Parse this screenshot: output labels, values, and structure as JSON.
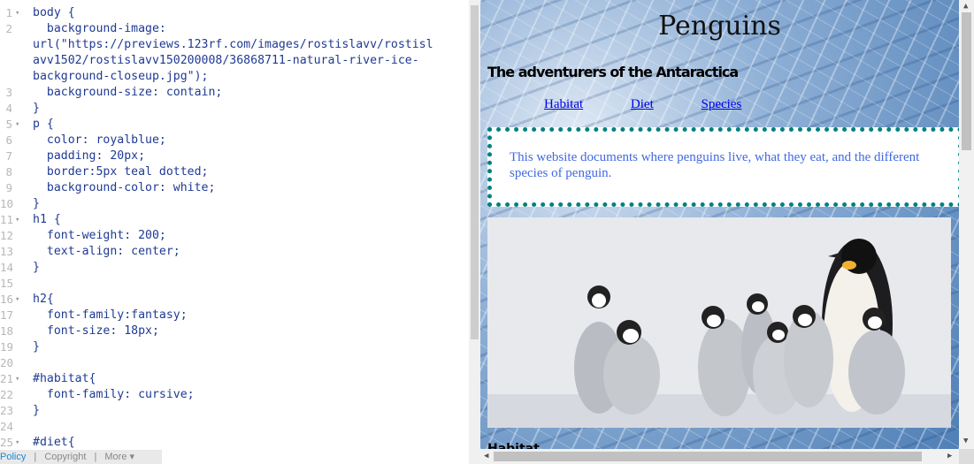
{
  "editor": {
    "lines": [
      {
        "n": "1",
        "fold": true,
        "html": "body {"
      },
      {
        "n": "2",
        "fold": false,
        "html": "  background-image:"
      },
      {
        "n": "",
        "fold": false,
        "html": "url(\"https://previews.123rf.com/images/rostislavv/rostisl"
      },
      {
        "n": "",
        "fold": false,
        "html": "avv1502/rostislavv150200008/36868711-natural-river-ice-"
      },
      {
        "n": "",
        "fold": false,
        "html": "background-closeup.jpg\");"
      },
      {
        "n": "3",
        "fold": false,
        "html": "  background-size: contain;"
      },
      {
        "n": "4",
        "fold": false,
        "html": "}"
      },
      {
        "n": "5",
        "fold": true,
        "html": "p {"
      },
      {
        "n": "6",
        "fold": false,
        "html": "  color: royalblue;"
      },
      {
        "n": "7",
        "fold": false,
        "html": "  padding: 20px;"
      },
      {
        "n": "8",
        "fold": false,
        "html": "  border:5px teal dotted;"
      },
      {
        "n": "9",
        "fold": false,
        "html": "  background-color: white;"
      },
      {
        "n": "10",
        "fold": false,
        "html": "}"
      },
      {
        "n": "11",
        "fold": true,
        "html": "h1 {"
      },
      {
        "n": "12",
        "fold": false,
        "html": "  font-weight: 200;"
      },
      {
        "n": "13",
        "fold": false,
        "html": "  text-align: center;"
      },
      {
        "n": "14",
        "fold": false,
        "html": "}"
      },
      {
        "n": "15",
        "fold": false,
        "html": ""
      },
      {
        "n": "16",
        "fold": true,
        "html": "h2{"
      },
      {
        "n": "17",
        "fold": false,
        "html": "  font-family:fantasy;"
      },
      {
        "n": "18",
        "fold": false,
        "html": "  font-size: 18px;"
      },
      {
        "n": "19",
        "fold": false,
        "html": "}"
      },
      {
        "n": "20",
        "fold": false,
        "html": ""
      },
      {
        "n": "21",
        "fold": true,
        "html": "#habitat{"
      },
      {
        "n": "22",
        "fold": false,
        "html": "  font-family: cursive;"
      },
      {
        "n": "23",
        "fold": false,
        "html": "}"
      },
      {
        "n": "24",
        "fold": false,
        "html": ""
      },
      {
        "n": "25",
        "fold": true,
        "html": "#diet{"
      }
    ],
    "footer": {
      "policy": "Policy",
      "copyright": "Copyright",
      "more": "More ▾"
    }
  },
  "preview": {
    "title": "Penguins",
    "subtitle": "The adventurers of the Antaractica",
    "nav": [
      "Habitat",
      "Diet",
      "Species"
    ],
    "paragraph": "This website documents where penguins live, what they eat, and the different species of penguin.",
    "next_heading": "Habitat"
  },
  "colors": {
    "paragraph_text": "#4169e1",
    "border": "#008080",
    "link": "#0000ee"
  }
}
